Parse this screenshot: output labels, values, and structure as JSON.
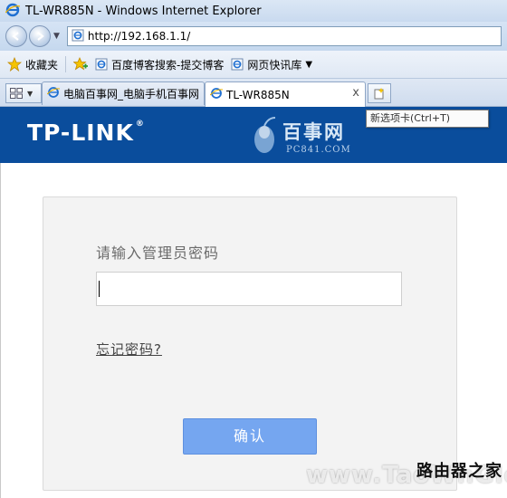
{
  "window": {
    "title": "TL-WR885N - Windows Internet Explorer"
  },
  "address_bar": {
    "url": "http://192.168.1.1/"
  },
  "favorites_bar": {
    "favorites_label": "收藏夹",
    "items": [
      {
        "label": "百度博客搜索-提交博客",
        "icon": "ie-page-icon"
      },
      {
        "label": "网页快讯库",
        "icon": "web-slice-icon",
        "has_dropdown": true
      }
    ]
  },
  "tabs": [
    {
      "label": "电脑百事网_电脑手机百事网",
      "active": false
    },
    {
      "label": "TL-WR885N",
      "active": true,
      "close_label": "x"
    }
  ],
  "new_tab_tooltip": "新选项卡(Ctrl+T)",
  "header": {
    "logo_text": "TP-LINK",
    "logo_mark": "®",
    "watermark_cn": "百事网",
    "watermark_en": "PC841.COM"
  },
  "login": {
    "prompt": "请输入管理员密码",
    "password_value": "",
    "forgot_link": "忘记密码?",
    "confirm_button": "确认"
  },
  "watermark_bottom": {
    "cn": "路由器之家",
    "en": "www.TaoWnGlobe"
  },
  "colors": {
    "tplink_header": "#0a4d9c",
    "confirm_button": "#75a6f0",
    "login_box": "#f3f3f3"
  }
}
